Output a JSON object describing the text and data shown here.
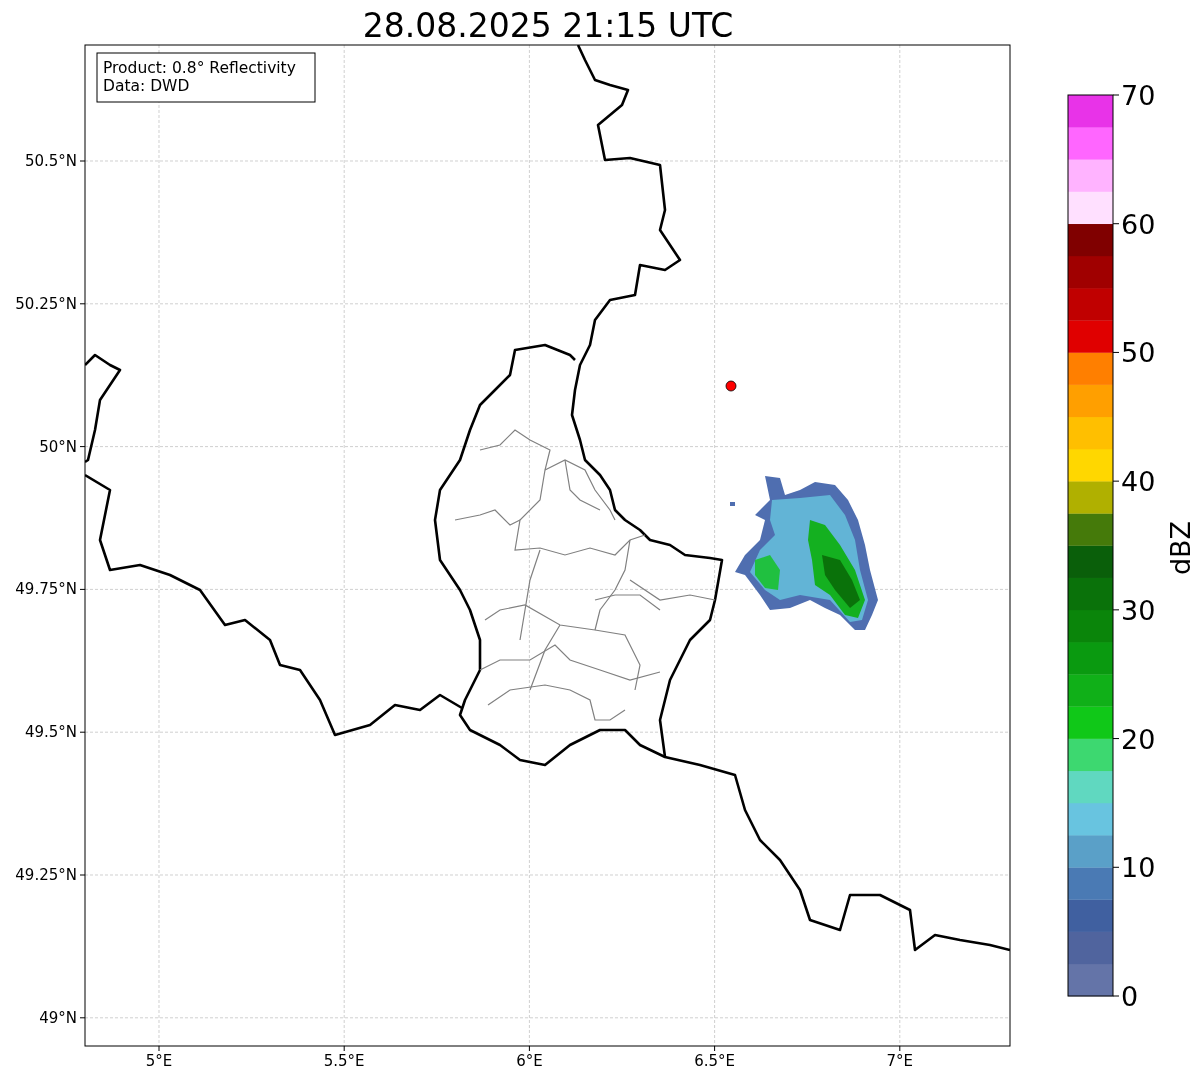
{
  "title": "28.08.2025 21:15 UTC",
  "map": {
    "info_box": [
      "Product: 0.8° Reflectivity",
      "Data: DWD"
    ],
    "lat_ticks": [
      "50.5°N",
      "50.25°N",
      "50°N",
      "49.75°N",
      "49.5°N",
      "49.25°N",
      "49°N"
    ],
    "lon_ticks": [
      "5°E",
      "5.5°E",
      "6°E",
      "6.5°E",
      "7°E"
    ]
  },
  "colorbar": {
    "label": "dBZ",
    "ticks": [
      "70",
      "60",
      "50",
      "40",
      "30",
      "20",
      "10",
      "0"
    ],
    "bins": [
      {
        "color": "#6474a8"
      },
      {
        "color": "#50649e"
      },
      {
        "color": "#4060a0"
      },
      {
        "color": "#4a7ab4"
      },
      {
        "color": "#5aa0c8"
      },
      {
        "color": "#68c4e0"
      },
      {
        "color": "#60d8c0"
      },
      {
        "color": "#3dd870"
      },
      {
        "color": "#10c818"
      },
      {
        "color": "#10b018"
      },
      {
        "color": "#0a9a10"
      },
      {
        "color": "#0a850a"
      },
      {
        "color": "#0a720a"
      },
      {
        "color": "#0a5f0a"
      },
      {
        "color": "#457a0a"
      },
      {
        "color": "#b0b000"
      },
      {
        "color": "#ffd700"
      },
      {
        "color": "#ffbf00"
      },
      {
        "color": "#ff9f00"
      },
      {
        "color": "#ff7f00"
      },
      {
        "color": "#e00000"
      },
      {
        "color": "#c00000"
      },
      {
        "color": "#a00000"
      },
      {
        "color": "#800000"
      },
      {
        "color": "#ffe0ff"
      },
      {
        "color": "#ffb3ff"
      },
      {
        "color": "#ff66ff"
      },
      {
        "color": "#e833e8"
      }
    ]
  }
}
